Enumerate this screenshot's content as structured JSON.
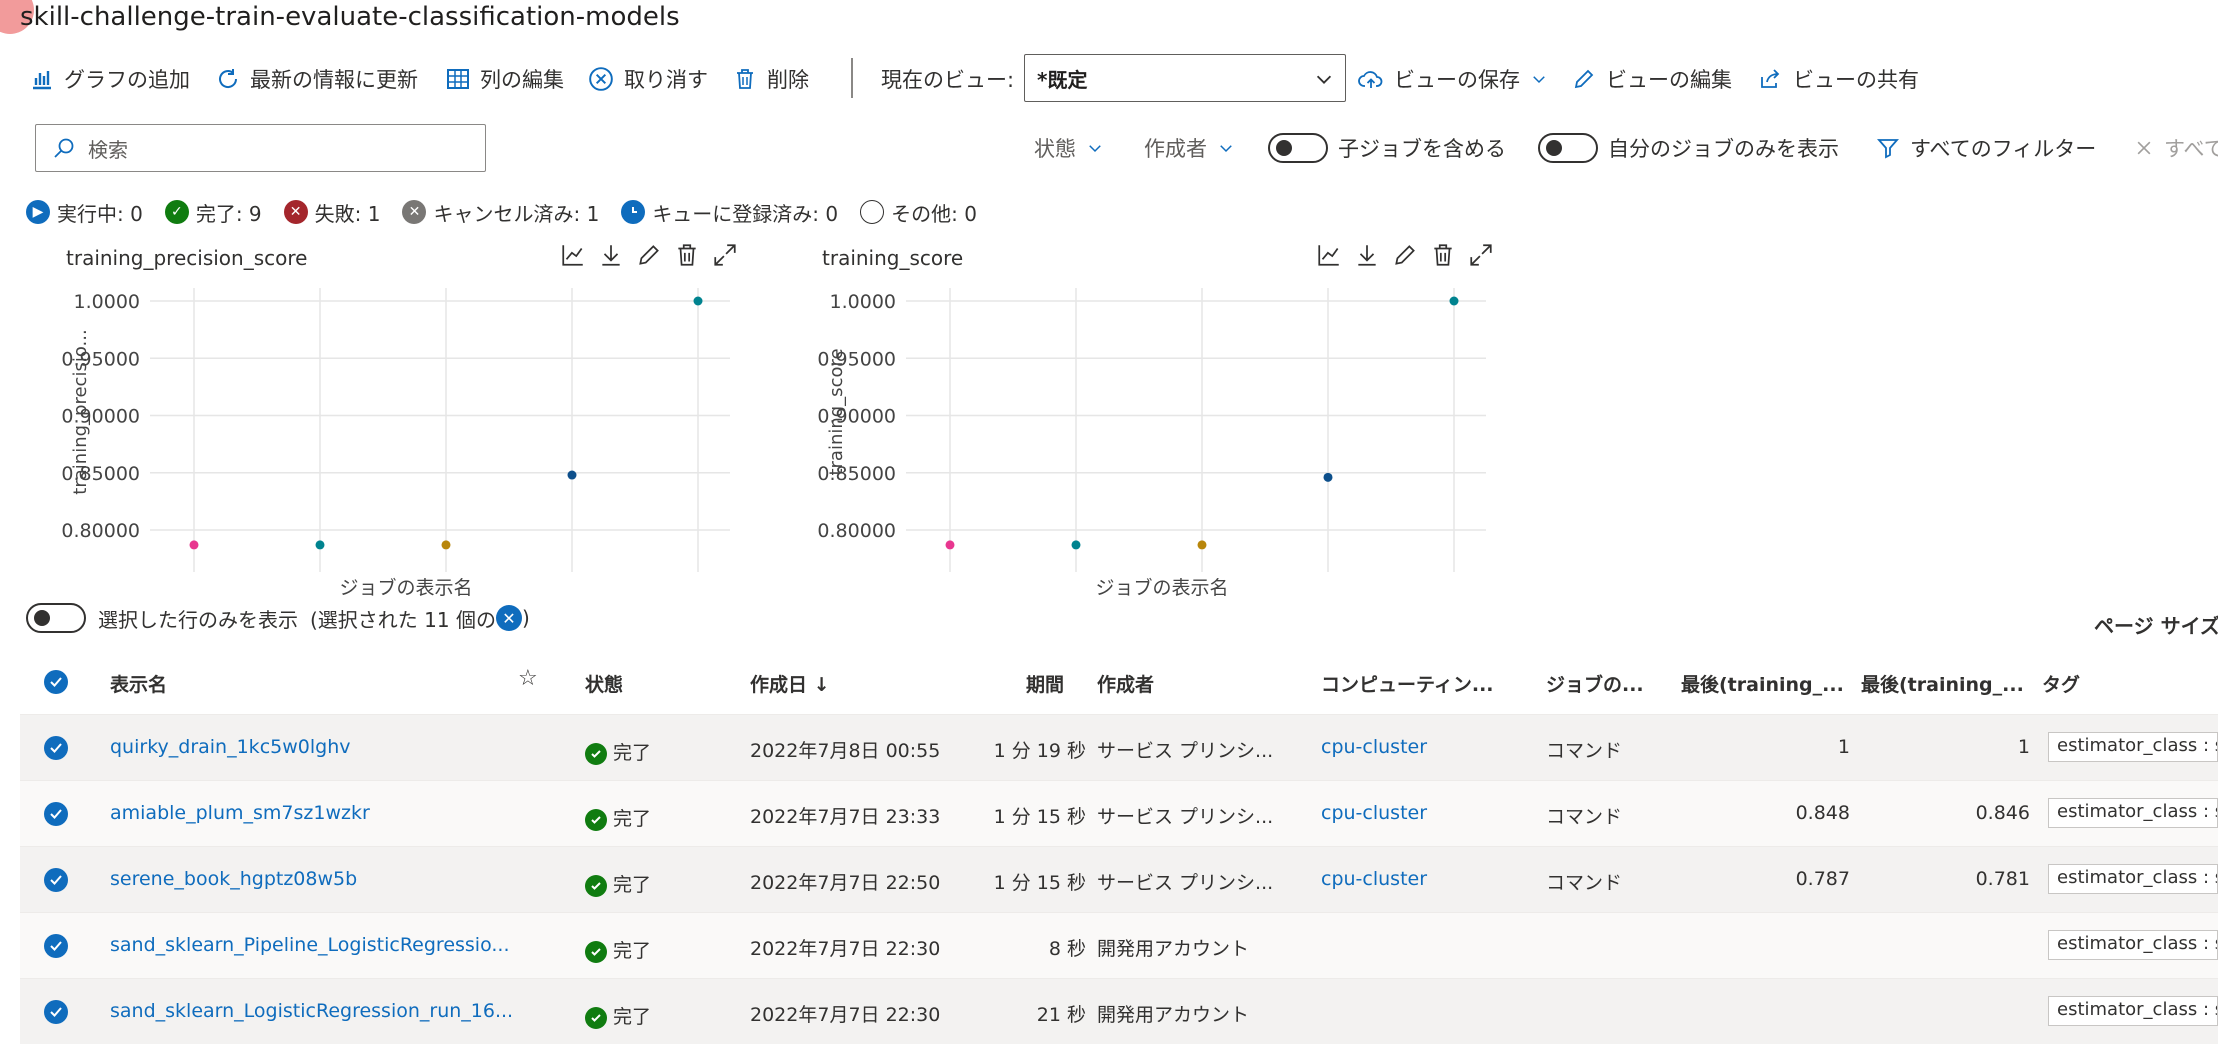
{
  "title": "skill-challenge-train-evaluate-classification-models",
  "toolbar": {
    "add_chart": "グラフの追加",
    "refresh": "最新の情報に更新",
    "edit_columns": "列の編集",
    "cancel": "取り消す",
    "delete": "削除",
    "current_view_label": "現在のビュー:",
    "current_view_value": "*既定",
    "save_view": "ビューの保存",
    "edit_view": "ビューの編集",
    "share_view": "ビューの共有"
  },
  "filters": {
    "search_placeholder": "検索",
    "status": "状態",
    "author": "作成者",
    "include_child_jobs": "子ジョブを含める",
    "only_my_jobs": "自分のジョブのみを表示",
    "all_filters": "すべてのフィルター",
    "clear_all": "すべて"
  },
  "status_counts": [
    {
      "label": "実行中: 0",
      "color": "#0f6cbd",
      "icon": "play-icon"
    },
    {
      "label": "完了: 9",
      "color": "#107c10",
      "icon": "check-icon"
    },
    {
      "label": "失敗: 1",
      "color": "#a4262c",
      "icon": "x-icon"
    },
    {
      "label": "キャンセル済み: 1",
      "color": "#797775",
      "icon": "x-icon"
    },
    {
      "label": "キューに登録済み: 0",
      "color": "#0f6cbd",
      "icon": "clock-icon"
    },
    {
      "label": "その他: 0",
      "color": "#ffffff",
      "icon": "circle-icon"
    }
  ],
  "chart_data": [
    {
      "type": "scatter",
      "title": "training_precision_score",
      "xlabel": "ジョブの表示名",
      "ylabel": "training_precisio...",
      "ylim": [
        0.78,
        1.0
      ],
      "yticks": [
        "1.0000",
        "0.95000",
        "0.90000",
        "0.85000",
        "0.80000"
      ],
      "points": [
        {
          "x": 1,
          "y": 0.787,
          "color": "#e8368f"
        },
        {
          "x": 2,
          "y": 0.787,
          "color": "#00838f"
        },
        {
          "x": 3,
          "y": 0.787,
          "color": "#b8860b"
        },
        {
          "x": 4,
          "y": 0.848,
          "color": "#0d4f8b"
        },
        {
          "x": 5,
          "y": 1.0,
          "color": "#00838f"
        }
      ]
    },
    {
      "type": "scatter",
      "title": "training_score",
      "xlabel": "ジョブの表示名",
      "ylabel": "training_score",
      "ylim": [
        0.78,
        1.0
      ],
      "yticks": [
        "1.0000",
        "0.95000",
        "0.90000",
        "0.85000",
        "0.80000"
      ],
      "points": [
        {
          "x": 1,
          "y": 0.787,
          "color": "#e8368f"
        },
        {
          "x": 2,
          "y": 0.787,
          "color": "#00838f"
        },
        {
          "x": 3,
          "y": 0.787,
          "color": "#b8860b"
        },
        {
          "x": 4,
          "y": 0.846,
          "color": "#0d4f8b"
        },
        {
          "x": 5,
          "y": 1.0,
          "color": "#00838f"
        }
      ]
    }
  ],
  "selection": {
    "only_selected": "選択した行のみを表示",
    "selected_count": "(選択された 11 個の",
    "close_paren": ")",
    "page_size": "ページ サイズ"
  },
  "table": {
    "headers": {
      "name": "表示名",
      "state": "状態",
      "created": "作成日 ↓",
      "duration": "期間",
      "author": "作成者",
      "compute": "コンピューティン...",
      "job_type": "ジョブの...",
      "last_precision": "最後(training_...",
      "last_score": "最後(training_...",
      "tags": "タグ"
    },
    "rows": [
      {
        "name": "quirky_drain_1kc5w0lghv",
        "state": "完了",
        "created": "2022年7月8日 00:55",
        "duration": "1 分 19 秒",
        "author": "サービス プリンシ...",
        "compute": "cpu-cluster",
        "job_type": "コマンド",
        "last_precision": "1",
        "last_score": "1",
        "tag": "estimator_class : sk"
      },
      {
        "name": "amiable_plum_sm7sz1wzkr",
        "state": "完了",
        "created": "2022年7月7日 23:33",
        "duration": "1 分 15 秒",
        "author": "サービス プリンシ...",
        "compute": "cpu-cluster",
        "job_type": "コマンド",
        "last_precision": "0.848",
        "last_score": "0.846",
        "tag": "estimator_class : sk"
      },
      {
        "name": "serene_book_hgptz08w5b",
        "state": "完了",
        "created": "2022年7月7日 22:50",
        "duration": "1 分 15 秒",
        "author": "サービス プリンシ...",
        "compute": "cpu-cluster",
        "job_type": "コマンド",
        "last_precision": "0.787",
        "last_score": "0.781",
        "tag": "estimator_class : sk"
      },
      {
        "name": "sand_sklearn_Pipeline_LogisticRegressio...",
        "state": "完了",
        "created": "2022年7月7日 22:30",
        "duration": "8 秒",
        "author": "開発用アカウント",
        "compute": "",
        "job_type": "",
        "last_precision": "",
        "last_score": "",
        "tag": "estimator_class : sk"
      },
      {
        "name": "sand_sklearn_LogisticRegression_run_16...",
        "state": "完了",
        "created": "2022年7月7日 22:30",
        "duration": "21 秒",
        "author": "開発用アカウント",
        "compute": "",
        "job_type": "",
        "last_precision": "",
        "last_score": "",
        "tag": "estimator_class : sk"
      }
    ]
  }
}
